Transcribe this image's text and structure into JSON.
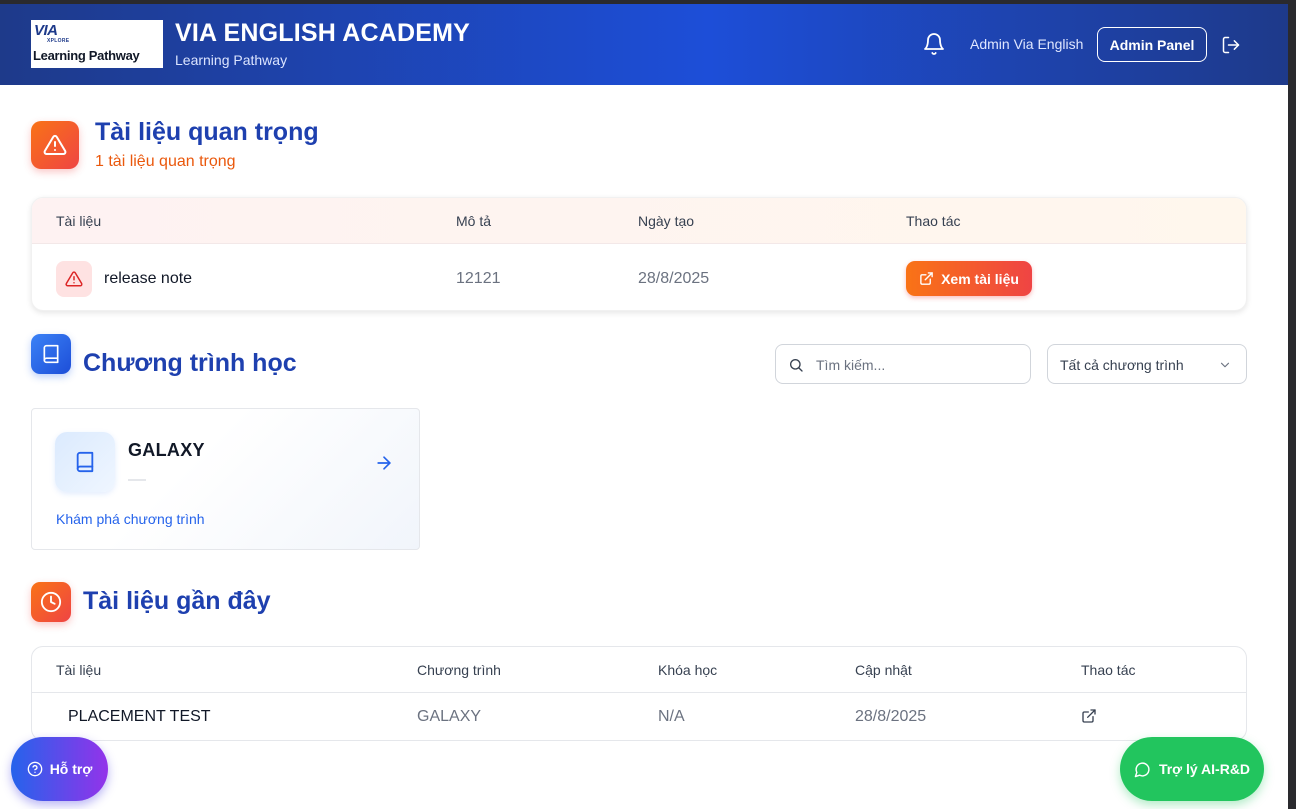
{
  "header": {
    "logo_line1": "VIA",
    "logo_line2": "XPLORE",
    "logo_line3": "Learning Pathway",
    "title": "VIA ENGLISH ACADEMY",
    "subtitle": "Learning Pathway",
    "user_name": "Admin Via English",
    "admin_button": "Admin Panel",
    "icons": {
      "notifications": "bell-icon",
      "logout": "logout-icon"
    }
  },
  "important_docs": {
    "title": "Tài liệu quan trọng",
    "subtitle": "1 tài liệu quan trọng",
    "columns": [
      "Tài liệu",
      "Mô tả",
      "Ngày tạo",
      "Thao tác"
    ],
    "rows": [
      {
        "name": "release note",
        "description": "12121",
        "created": "28/8/2025",
        "action": "Xem tài liệu"
      }
    ]
  },
  "programs": {
    "title": "Chương trình học",
    "search_placeholder": "Tìm kiếm...",
    "filter_value": "Tất cả chương trình",
    "cards": [
      {
        "title": "GALAXY",
        "link": "Khám phá chương trình"
      }
    ]
  },
  "recent_docs": {
    "title": "Tài liệu gần đây",
    "columns": [
      "Tài liệu",
      "Chương trình",
      "Khóa học",
      "Cập nhật",
      "Thao tác"
    ],
    "rows": [
      {
        "name": "PLACEMENT TEST",
        "program": "GALAXY",
        "course": "N/A",
        "updated": "28/8/2025"
      }
    ]
  },
  "floating": {
    "help": "Hỗ trợ",
    "ai": "Trợ lý AI-R&D"
  },
  "colors": {
    "header": "#1e40af",
    "section_title": "#1e40af",
    "warning_gradient": "#ef4444",
    "ai_button": "#22c55e"
  }
}
